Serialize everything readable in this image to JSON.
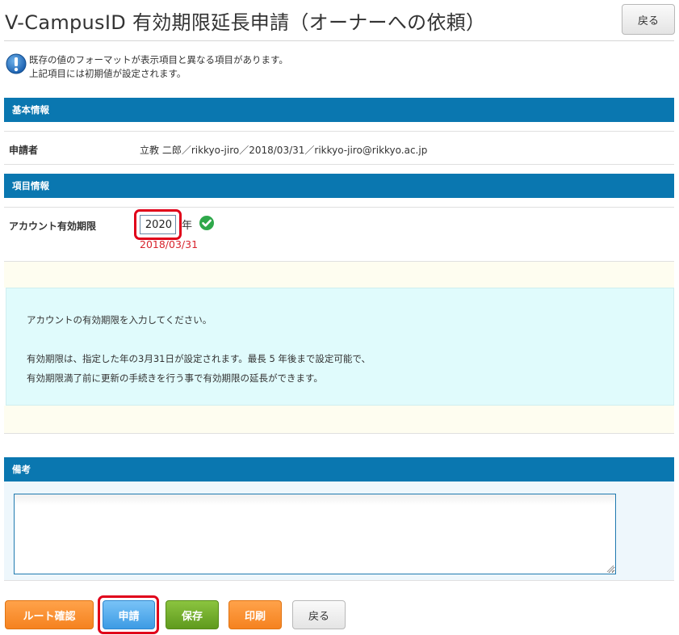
{
  "header": {
    "title": "V-CampusID 有効期限延長申請（オーナーへの依頼）",
    "back_label": "戻る"
  },
  "notice": {
    "icon": "info-exclamation-icon",
    "line1": "既存の値のフォーマットが表示項目と異なる項目があります。",
    "line2": "上記項目には初期値が設定されます。"
  },
  "basic_info": {
    "section_title": "基本情報",
    "applicant_label": "申請者",
    "applicant_value": "立教 二郎／rikkyo-jiro／2018/03/31／rikkyo-jiro@rikkyo.ac.jp"
  },
  "item_info": {
    "section_title": "項目情報",
    "expiry_label": "アカウント有効期限",
    "year_value": "2020",
    "year_unit": "年",
    "valid_icon": "check-circle-icon",
    "current_expiry": "2018/03/31"
  },
  "help": {
    "line1": "アカウントの有効期限を入力してください。",
    "line2": "有効期限は、指定した年の3月31日が設定されます。最長 5 年後まで設定可能で、",
    "line3": "有効期限満了前に更新の手続きを行う事で有効期限の延長ができます。"
  },
  "remarks": {
    "section_title": "備考",
    "value": ""
  },
  "actions": {
    "route_check": "ルート確認",
    "apply": "申請",
    "save": "保存",
    "print": "印刷",
    "back": "戻る"
  },
  "colors": {
    "section_bar": "#0a77b0",
    "highlight": "#e0001a",
    "error_text": "#d8242d",
    "help_bg": "#e0fbfc",
    "button_orange": "#f5821f",
    "button_blue": "#3d9be4",
    "button_green": "#5f9a1e"
  }
}
